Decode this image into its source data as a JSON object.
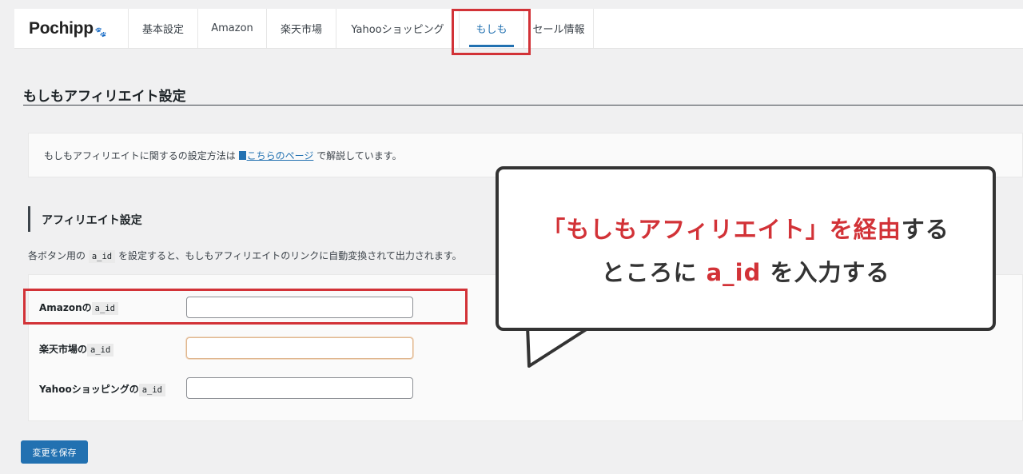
{
  "logo": {
    "text": "Pochipp",
    "paw": "🐾"
  },
  "tabs": [
    {
      "label": "基本設定"
    },
    {
      "label": "Amazon"
    },
    {
      "label": "楽天市場"
    },
    {
      "label": "Yahooショッピング"
    },
    {
      "label": "もしも",
      "active": true
    },
    {
      "label": "セール情報"
    }
  ],
  "page": {
    "title": "もしもアフィリエイト設定"
  },
  "notice": {
    "prefix": "もしもアフィリエイトに関するの設定方法は ",
    "link": "こちらのページ",
    "suffix": " で解説しています。"
  },
  "section": {
    "title": "アフィリエイト設定",
    "desc_prefix": "各ボタン用の ",
    "desc_code": "a_id",
    "desc_suffix": " を設定すると、もしもアフィリエイトのリンクに自動変換されて出力されます。"
  },
  "fields": [
    {
      "label": "Amazonの",
      "code": "a_id",
      "value": ""
    },
    {
      "label": "楽天市場の",
      "code": "a_id",
      "value": ""
    },
    {
      "label": "Yahooショッピングの",
      "code": "a_id",
      "value": ""
    }
  ],
  "save_button": "変更を保存",
  "callout": {
    "line1_red": "「もしもアフィリエイト」を経由",
    "line1_black": "する",
    "line2_a": "ところに ",
    "line2_red": "a_id",
    "line2_b": " を入力する"
  },
  "colors": {
    "accent": "#2271b1",
    "highlight": "#d23237"
  }
}
